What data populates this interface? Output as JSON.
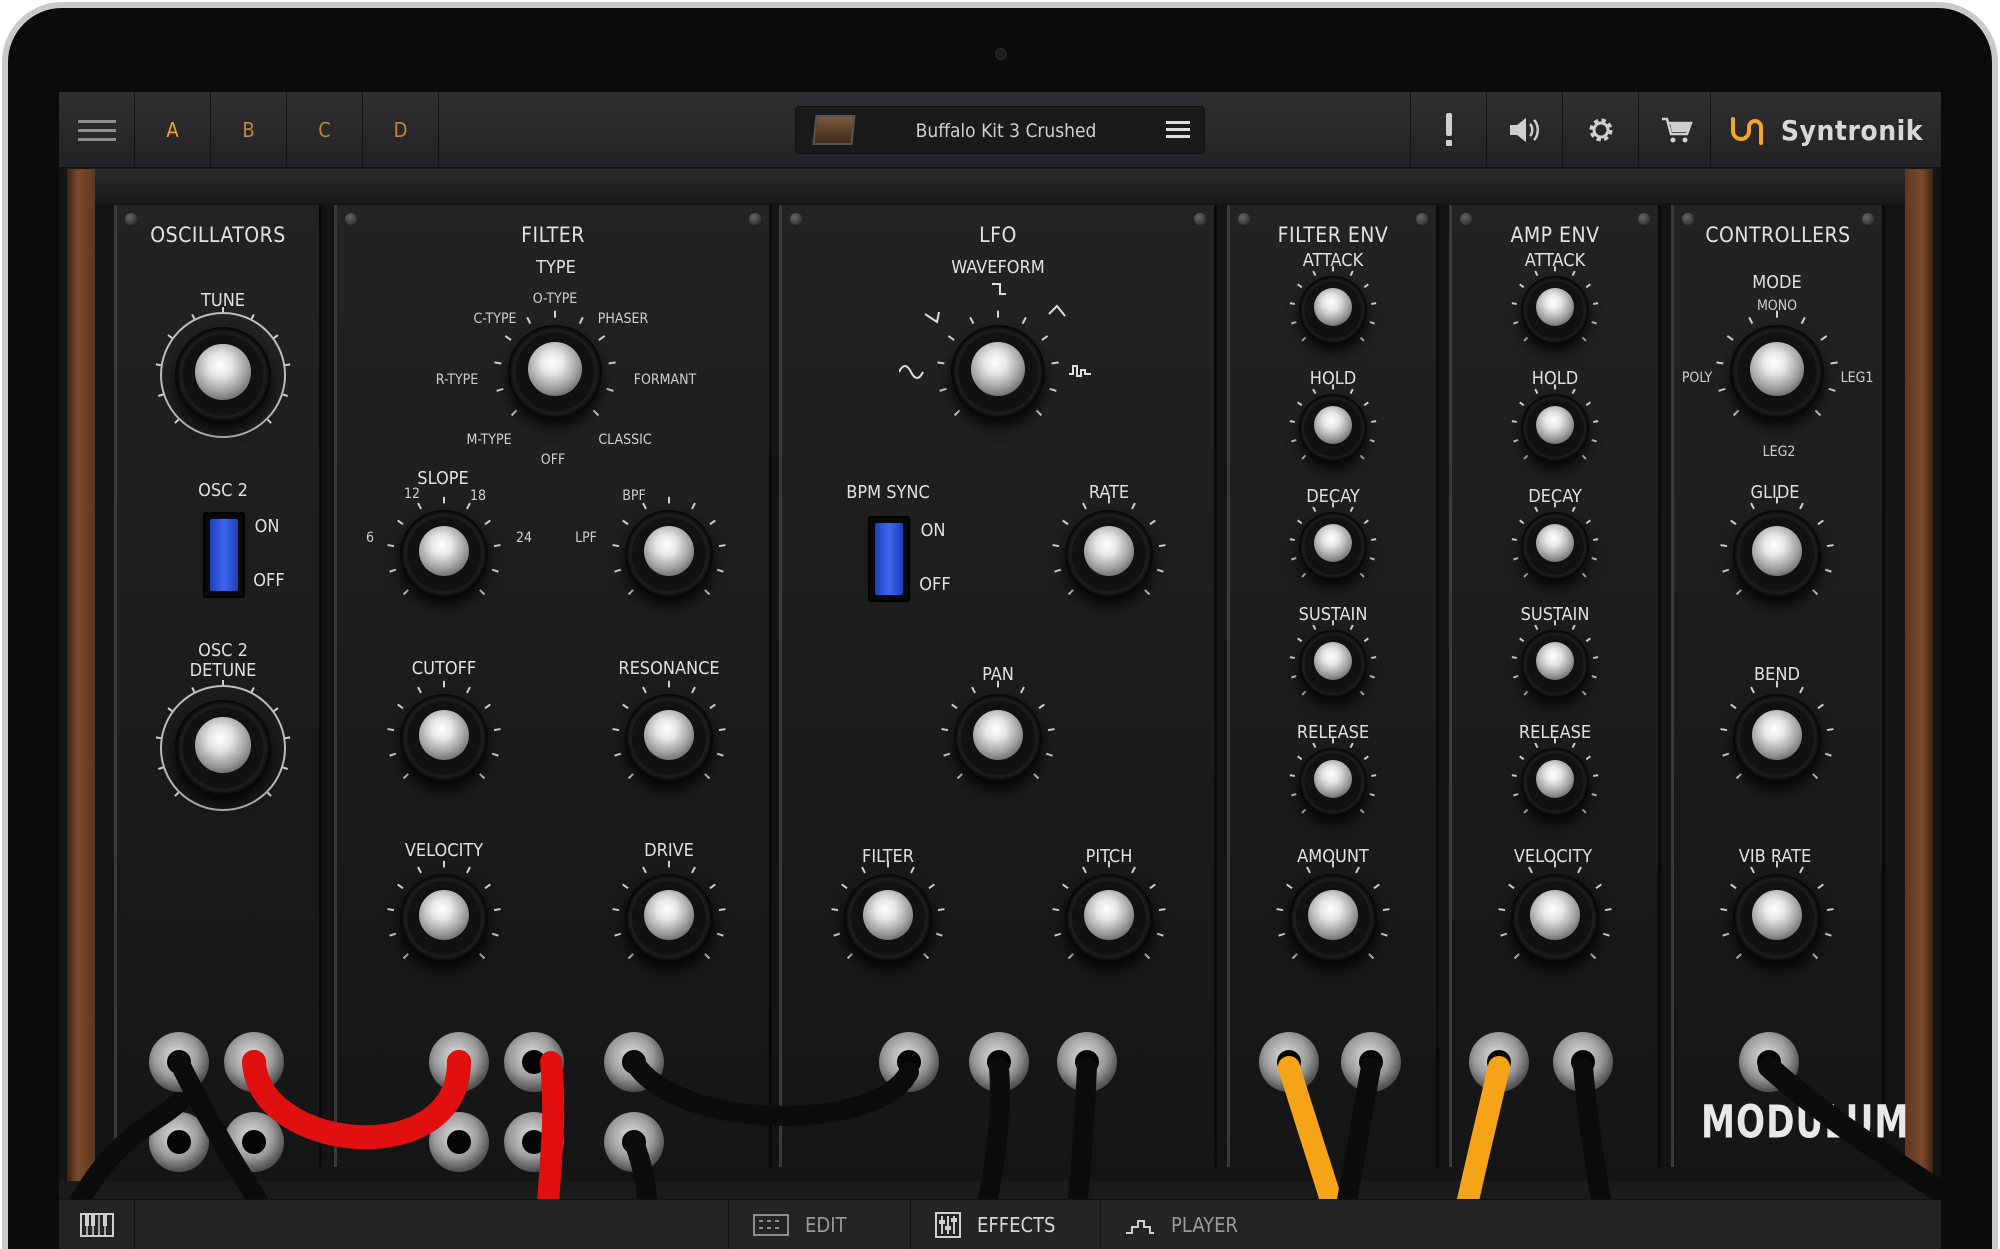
{
  "topbar": {
    "slots": [
      "A",
      "B",
      "C",
      "D"
    ],
    "active_slot": "A",
    "preset_name": "Buffalo Kit 3 Crushed",
    "brand": "Syntronik"
  },
  "panels": {
    "oscillators": {
      "title": "OSCILLATORS",
      "tune": "TUNE",
      "osc2": "OSC 2",
      "on": "ON",
      "off": "OFF",
      "detune_1": "OSC 2",
      "detune_2": "DETUNE"
    },
    "filter": {
      "title": "FILTER",
      "type": "TYPE",
      "types": {
        "c_type": "C-TYPE",
        "o_type": "O-TYPE",
        "phaser": "PHASER",
        "r_type": "R-TYPE",
        "formant": "FORMANT",
        "m_type": "M-TYPE",
        "off": "OFF",
        "classic": "CLASSIC"
      },
      "slope": "SLOPE",
      "slope_12": "12",
      "slope_18": "18",
      "slope_6": "6",
      "slope_24": "24",
      "bpf": "BPF",
      "lpf": "LPF",
      "cutoff": "CUTOFF",
      "resonance": "RESONANCE",
      "velocity": "VELOCITY",
      "drive": "DRIVE"
    },
    "lfo": {
      "title": "LFO",
      "waveform": "WAVEFORM",
      "bpm_sync": "BPM SYNC",
      "on": "ON",
      "off": "OFF",
      "rate": "RATE",
      "pan": "PAN",
      "filter": "FILTER",
      "pitch": "PITCH"
    },
    "filter_env": {
      "title": "FILTER ENV",
      "attack": "ATTACK",
      "hold": "HOLD",
      "decay": "DECAY",
      "sustain": "SUSTAIN",
      "release": "RELEASE",
      "amount": "AMOUNT"
    },
    "amp_env": {
      "title": "AMP ENV",
      "attack": "ATTACK",
      "hold": "HOLD",
      "decay": "DECAY",
      "sustain": "SUSTAIN",
      "release": "RELEASE",
      "velocity": "VELOCITY"
    },
    "controllers": {
      "title": "CONTROLLERS",
      "mode": "MODE",
      "mono": "MONO",
      "poly": "POLY",
      "leg1": "LEG1",
      "leg2": "LEG2",
      "glide": "GLIDE",
      "bend": "BEND",
      "vib_rate": "VIB RATE",
      "product": "MODULUM"
    }
  },
  "bottombar": {
    "edit": "EDIT",
    "effects": "EFFECTS",
    "player": "PLAYER",
    "active_tab": "EFFECTS"
  },
  "colors": {
    "accent": "#f3a52a",
    "switch_blue": "#3d66f0",
    "cable_red": "#e01010",
    "cable_yellow": "#f5a418",
    "cable_black": "#0c0c0c"
  }
}
